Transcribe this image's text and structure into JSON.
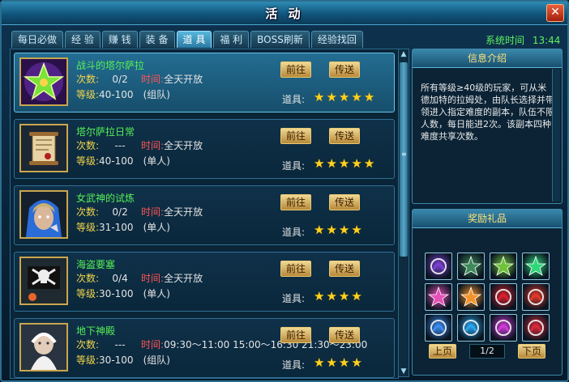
{
  "window": {
    "title": "活 动",
    "close_label": "✕"
  },
  "tabs": [
    {
      "label": "每日必做",
      "active": false
    },
    {
      "label": "经 验",
      "active": false
    },
    {
      "label": "赚 钱",
      "active": false
    },
    {
      "label": "装 备",
      "active": false
    },
    {
      "label": "道 具",
      "active": true
    },
    {
      "label": "福 利",
      "active": false
    },
    {
      "label": "BOSS刷新",
      "active": false
    },
    {
      "label": "经验找回",
      "active": false
    }
  ],
  "system_time": {
    "label": "系统时间",
    "value": "13:44"
  },
  "activities": [
    {
      "name": "战斗的塔尔萨拉",
      "count_label": "次数:",
      "count": "0/2",
      "time_label": "时间:",
      "time": "全天开放",
      "level_label": "等级:",
      "level": "40-100",
      "team": "(组队)",
      "item_label": "道具:",
      "stars": 5,
      "selected": true,
      "go_label": "前往",
      "tp_label": "传送",
      "thumb": "star-icon"
    },
    {
      "name": "塔尔萨拉日常",
      "count_label": "次数:",
      "count": "---",
      "time_label": "时间:",
      "time": "全天开放",
      "level_label": "等级:",
      "level": "40-100",
      "team": "(单人)",
      "item_label": "道具:",
      "stars": 5,
      "selected": false,
      "go_label": "前往",
      "tp_label": "传送",
      "thumb": "scroll-icon"
    },
    {
      "name": "女武神的试炼",
      "count_label": "次数:",
      "count": "0/2",
      "time_label": "时间:",
      "time": "全天开放",
      "level_label": "等级:",
      "level": "31-100",
      "team": "(单人)",
      "item_label": "道具:",
      "stars": 4,
      "selected": false,
      "go_label": "前往",
      "tp_label": "传送",
      "thumb": "valkyrie-portrait-icon"
    },
    {
      "name": "海盗要塞",
      "count_label": "次数:",
      "count": "0/4",
      "time_label": "时间:",
      "time": "全天开放",
      "level_label": "等级:",
      "level": "30-100",
      "team": "(单人)",
      "item_label": "道具:",
      "stars": 4,
      "selected": false,
      "go_label": "前往",
      "tp_label": "传送",
      "thumb": "pirate-flag-icon"
    },
    {
      "name": "地下神殿",
      "count_label": "次数:",
      "count": "---",
      "time_label": "时间:",
      "time": "09:30～11:00 15:00～16:30 21:30～23:00",
      "level_label": "等级:",
      "level": "30-100",
      "team": "(组队)",
      "item_label": "道具:",
      "stars": 4,
      "selected": false,
      "go_label": "前往",
      "tp_label": "传送",
      "thumb": "wizard-portrait-icon"
    }
  ],
  "info_panel": {
    "title": "信息介绍",
    "text": "所有等级≥40级的玩家，可从米德加特的拉姆处，由队长选择并带领进入指定难度的副本，队伍不限人数，每日能进2次。该副本四种难度共享次数。"
  },
  "rewards_panel": {
    "title": "奖励礼品",
    "items": [
      {
        "icon": "purple-orb-icon",
        "color": "#7a3fd1"
      },
      {
        "icon": "dark-star-icon",
        "color": "#3f8a5a"
      },
      {
        "icon": "green-star-icon",
        "color": "#6fc23a"
      },
      {
        "icon": "emerald-star-icon",
        "color": "#2fd67a"
      },
      {
        "icon": "pink-star-icon",
        "color": "#e64fb8"
      },
      {
        "icon": "orange-star-icon",
        "color": "#f2932a"
      },
      {
        "icon": "red-rune-icon",
        "color": "#d8202d"
      },
      {
        "icon": "red-swirl-icon",
        "color": "#e03a2a"
      },
      {
        "icon": "blue-rune-icon",
        "color": "#3c8cf0"
      },
      {
        "icon": "blue-orb-icon",
        "color": "#2aa6ee"
      },
      {
        "icon": "magenta-rune-icon",
        "color": "#d03ad8"
      },
      {
        "icon": "red-claw-icon",
        "color": "#d92a3a"
      }
    ],
    "prev_label": "上页",
    "page": "1/2",
    "next_label": "下页"
  }
}
